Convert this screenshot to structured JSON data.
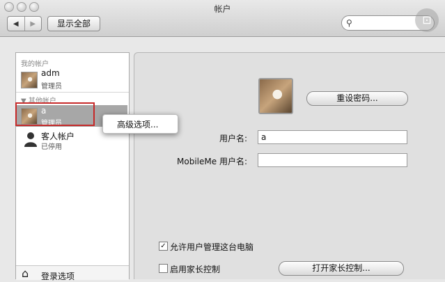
{
  "window": {
    "title": "帐户"
  },
  "toolbar": {
    "back": "◀",
    "forward": "▶",
    "show_all": "显示全部",
    "search_placeholder": ""
  },
  "sidebar": {
    "my_account_label": "我的帐户",
    "my_account": {
      "name": "adm",
      "role": "管理员"
    },
    "other_label": "▼ 其他帐户",
    "others": [
      {
        "name": "a",
        "role": "管理员"
      },
      {
        "name": "客人帐户",
        "role": "已停用"
      }
    ],
    "login_options": "登录选项"
  },
  "context_menu": {
    "item": "高级选项..."
  },
  "detail": {
    "reset_password": "重设密码...",
    "username_label": "用户名:",
    "username_value": "a",
    "mobileme_label": "MobileMe 用户名:",
    "mobileme_value": "",
    "allow_admin": "允许用户管理这台电脑",
    "allow_admin_checked": true,
    "parental_label": "启用家长控制",
    "parental_checked": false,
    "open_parental": "打开家长控制..."
  }
}
